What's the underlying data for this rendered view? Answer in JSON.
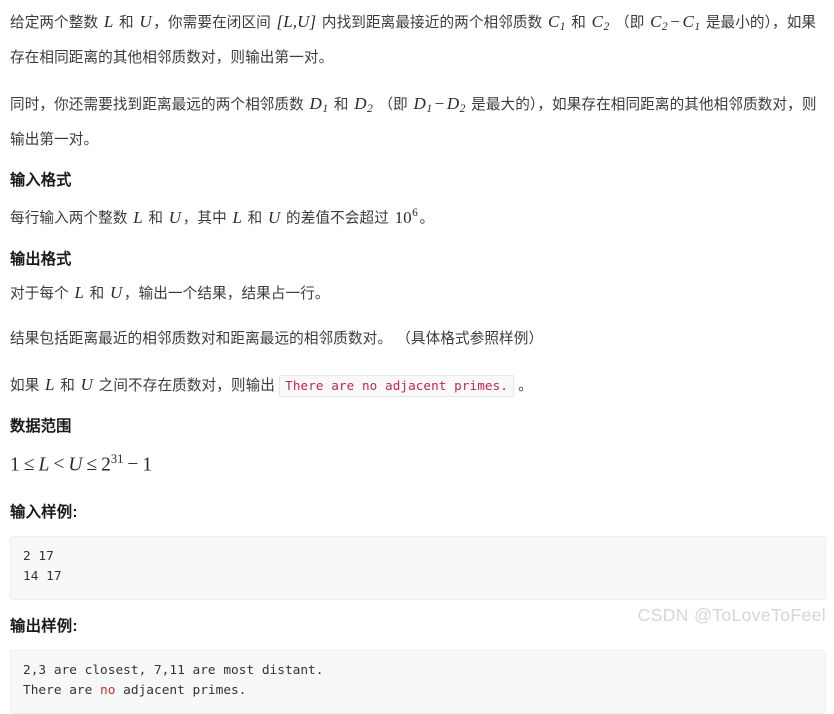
{
  "document": {
    "paragraphs": {
      "p1_a": "给定两个整数 ",
      "p1_L": "L",
      "p1_b": " 和 ",
      "p1_U": "U",
      "p1_c": "，你需要在闭区间 ",
      "p1_interval": "[L,U]",
      "p1_d": " 内找到距离最接近的两个相邻质数 ",
      "p1_C1": "C",
      "p1_C1sub": "1",
      "p1_e": " 和 ",
      "p1_C2": "C",
      "p1_C2sub": "2",
      "p1_f": " （即 ",
      "p1_diff_C2": "C",
      "p1_diff_C2sub": "2",
      "p1_minus": "−",
      "p1_diff_C1": "C",
      "p1_diff_C1sub": "1",
      "p1_g": " 是最小的），如果存在相同距离的其他相邻质数对，则输出第一对。",
      "p2_a": "同时，你还需要找到距离最远的两个相邻质数 ",
      "p2_D1": "D",
      "p2_D1sub": "1",
      "p2_b": " 和 ",
      "p2_D2": "D",
      "p2_D2sub": "2",
      "p2_c": " （即 ",
      "p2_diff_D1": "D",
      "p2_diff_D1sub": "1",
      "p2_minus": "−",
      "p2_diff_D2": "D",
      "p2_diff_D2sub": "2",
      "p2_d": " 是最大的），如果存在相同距离的其他相邻质数对，则输出第一对。",
      "p3_a": "每行输入两个整数 ",
      "p3_L": "L",
      "p3_b": " 和 ",
      "p3_U": "U",
      "p3_c": "，其中 ",
      "p3_L2": "L",
      "p3_d": " 和 ",
      "p3_U2": "U",
      "p3_e": " 的差值不会超过 ",
      "p3_base": "10",
      "p3_exp": "6",
      "p3_f": "。",
      "p4_a": "对于每个 ",
      "p4_L": "L",
      "p4_b": " 和 ",
      "p4_U": "U",
      "p4_c": "，输出一个结果，结果占一行。",
      "p5": "结果包括距离最近的相邻质数对和距离最远的相邻质数对。 （具体格式参照样例）",
      "p6_a": "如果 ",
      "p6_L": "L",
      "p6_b": " 和 ",
      "p6_U": "U",
      "p6_c": " 之间不存在质数对，则输出 ",
      "p6_code": "There are no adjacent primes.",
      "p6_d": " 。"
    },
    "headings": {
      "input_format": "输入格式",
      "output_format": "输出格式",
      "data_range": "数据范围",
      "input_sample": "输入样例:",
      "output_sample": "输出样例:"
    },
    "formula": {
      "one": "1",
      "le1": "≤",
      "L": "L",
      "lt": "<",
      "U": "U",
      "le2": "≤",
      "two": "2",
      "exp": "31",
      "minus": "−",
      "final_one": "1"
    },
    "input_sample_lines": [
      "2 17",
      "14 17"
    ],
    "output_sample_lines": [
      {
        "segments": [
          {
            "text": "2,3 are closest, 7,11 are most distant.",
            "style": "plain"
          }
        ]
      },
      {
        "segments": [
          {
            "text": "There are ",
            "style": "plain"
          },
          {
            "text": "no",
            "style": "keyword"
          },
          {
            "text": " adjacent primes.",
            "style": "plain"
          }
        ]
      }
    ],
    "watermark": "CSDN @ToLoveToFeel",
    "colors": {
      "inline_code_text": "#c7254e",
      "code_block_bg": "#f7f8fa",
      "keyword_red": "#c0341d",
      "watermark": "#d2d6db",
      "body_text": "#3b3b3b",
      "heading_text": "#1a1a1a"
    }
  }
}
